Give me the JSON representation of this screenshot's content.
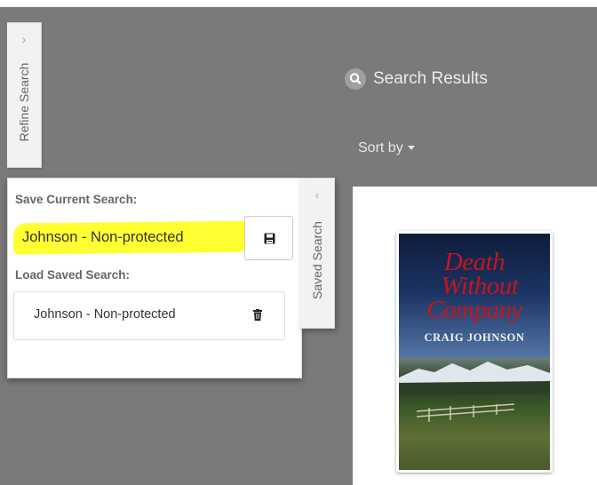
{
  "refine_tab": {
    "label": "Refine Search",
    "chevron_icon": "chevron-right-icon"
  },
  "saved_panel": {
    "save_heading": "Save Current Search:",
    "save_input_value": "Johnson - Non-protected",
    "save_button_icon": "floppy-disk-icon",
    "load_heading": "Load Saved Search:",
    "saved_searches": [
      {
        "label": "Johnson - Non-protected",
        "delete_icon": "trash-icon"
      }
    ],
    "highlight_color": "#ffff32"
  },
  "saved_tab": {
    "label": "Saved Search",
    "chevron_icon": "chevron-left-icon"
  },
  "results": {
    "icon": "search-icon",
    "title": "Search Results",
    "sort_label": "Sort by",
    "sort_icon": "caret-down-icon",
    "items": [
      {
        "cover_title_lines": [
          "Death",
          "Without",
          "Company"
        ],
        "cover_author": "CRAIG JOHNSON"
      }
    ]
  }
}
